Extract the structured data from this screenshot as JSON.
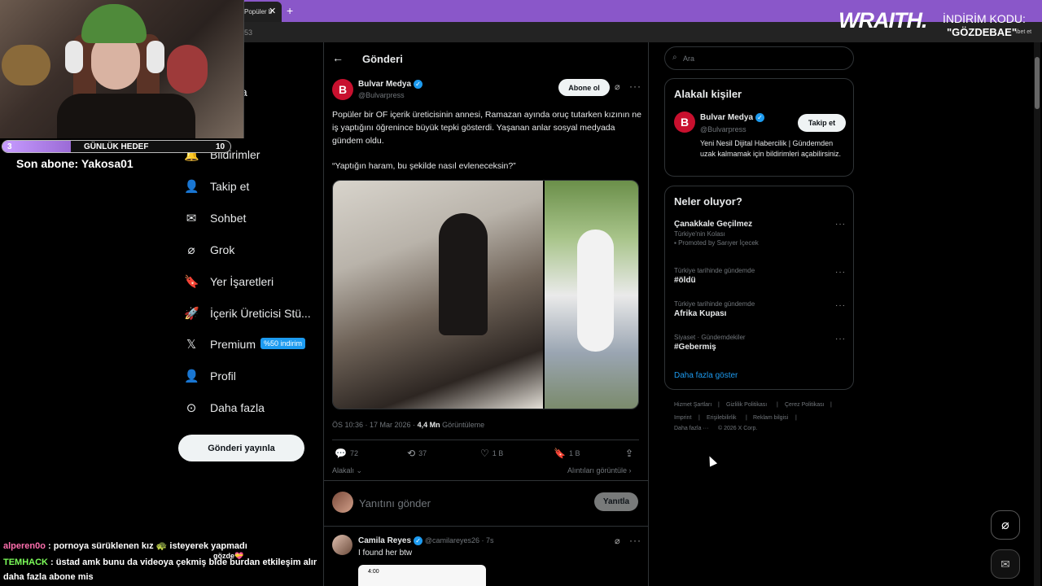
{
  "browser": {
    "tab_title": "Popüler b",
    "tab_close": "✕",
    "new_tab": "+",
    "address_fragment": "53",
    "extension_label": "ibet et"
  },
  "sponsor": {
    "brand": "WRAITH.",
    "discount_label": "İNDİRİM KODU:",
    "discount_code": "\"GÖZDEBAE\""
  },
  "stream": {
    "goal": {
      "current": "3",
      "label": "GÜNLÜK HEDEF",
      "target": "10",
      "progress": 0.3
    },
    "last_sub": "Son abone: Yakosa01",
    "chat": [
      {
        "user": "alperen0o",
        "message": " : pornoya sürüklenen kız 🐢 isteyerek yapmadı"
      },
      {
        "user": "TEMHACK",
        "message": " : üstad amk bunu da videoya çekmiş bide burdan etkileşim alır"
      },
      {
        "user": "",
        "message": "daha fazla abone mis"
      }
    ],
    "chat_badge": "gözde💝"
  },
  "nav": {
    "partial_item": "fa",
    "items": [
      {
        "label": "Bildirimler",
        "icon": "bell-icon"
      },
      {
        "label": "Takip et",
        "icon": "person-add-icon"
      },
      {
        "label": "Sohbet",
        "icon": "mail-icon"
      },
      {
        "label": "Grok",
        "icon": "grok-icon"
      },
      {
        "label": "Yer İşaretleri",
        "icon": "bookmark-icon"
      },
      {
        "label": "İçerik Üreticisi Stü...",
        "icon": "rocket-icon"
      },
      {
        "label": "Premium",
        "icon": "x-logo-icon"
      },
      {
        "label": "Profil",
        "icon": "profile-icon"
      },
      {
        "label": "Daha fazla",
        "icon": "more-circle-icon"
      }
    ],
    "premium_badge": "%50 indirim",
    "post_button": "Gönderi yayınla"
  },
  "post": {
    "header_title": "Gönderi",
    "author_avatar": "B",
    "author_name": "Bulvar Medya",
    "author_handle": "@Bulvarpress",
    "follow_label": "Abone ol",
    "text": "Popüler bir OF içerik üreticisinin annesi, Ramazan ayında oruç tutarken kızının ne iş yaptığını öğrenince büyük tepki gösterdi. Yaşanan anlar sosyal medyada gündem oldu.",
    "quote": "“Yaptığın haram, bu şekilde nasıl evleneceksin?”",
    "timestamp": "ÖS 10:36 · 17 Mar 2026 · ",
    "views": "4,4 Mn",
    "views_label": " Görüntüleme",
    "stats": {
      "replies": "72",
      "reposts": "37",
      "likes": "1 B",
      "bookmarks": "1 B"
    },
    "related_label": "Alakalı",
    "quotes_link": "Alıntıları görüntüle ›",
    "reply_placeholder": "Yanıtını gönder",
    "reply_button": "Yanıtla"
  },
  "comment": {
    "name": "Camila Reyes",
    "handle": "@camilareyes26 · 7s",
    "text": "I found her btw",
    "phone_time": "4:00"
  },
  "sidebar": {
    "search_placeholder": "Ara",
    "related_title": "Alakalı kişiler",
    "related_person": {
      "name": "Bulvar Medya",
      "handle": "@Bulvarpress",
      "follow": "Takip et",
      "bio": "Yeni Nesil Dijital Habercilik | Gündemden uzak kalmamak için bildirimleri açabilirsiniz."
    },
    "trends_title": "Neler oluyor?",
    "trends": [
      {
        "context": "",
        "name": "Çanakkale Geçilmez",
        "sub": "Türkiye'nin Kolası",
        "promo": "Promoted by Sarıyer İçecek"
      },
      {
        "context": "Türkiye tarihinde gündemde",
        "name": "#öldü"
      },
      {
        "context": "Türkiye tarihinde gündemde",
        "name": "Afrika Kupası"
      },
      {
        "context": "Siyaset · Gündemdekiler",
        "name": "#Gebermiş"
      }
    ],
    "show_more": "Daha fazla göster",
    "footer_links": [
      "Hizmet Şartları",
      "Gizlilik Politikası",
      "Çerez Politikası",
      "Imprint",
      "Erişilebilirlik",
      "Reklam bilgisi",
      "Daha fazla ···",
      "© 2026 X Corp."
    ]
  },
  "colors": {
    "accent": "#1d9bf0",
    "tab_bar": "#8a57c9",
    "brand_red": "#c8102e"
  }
}
